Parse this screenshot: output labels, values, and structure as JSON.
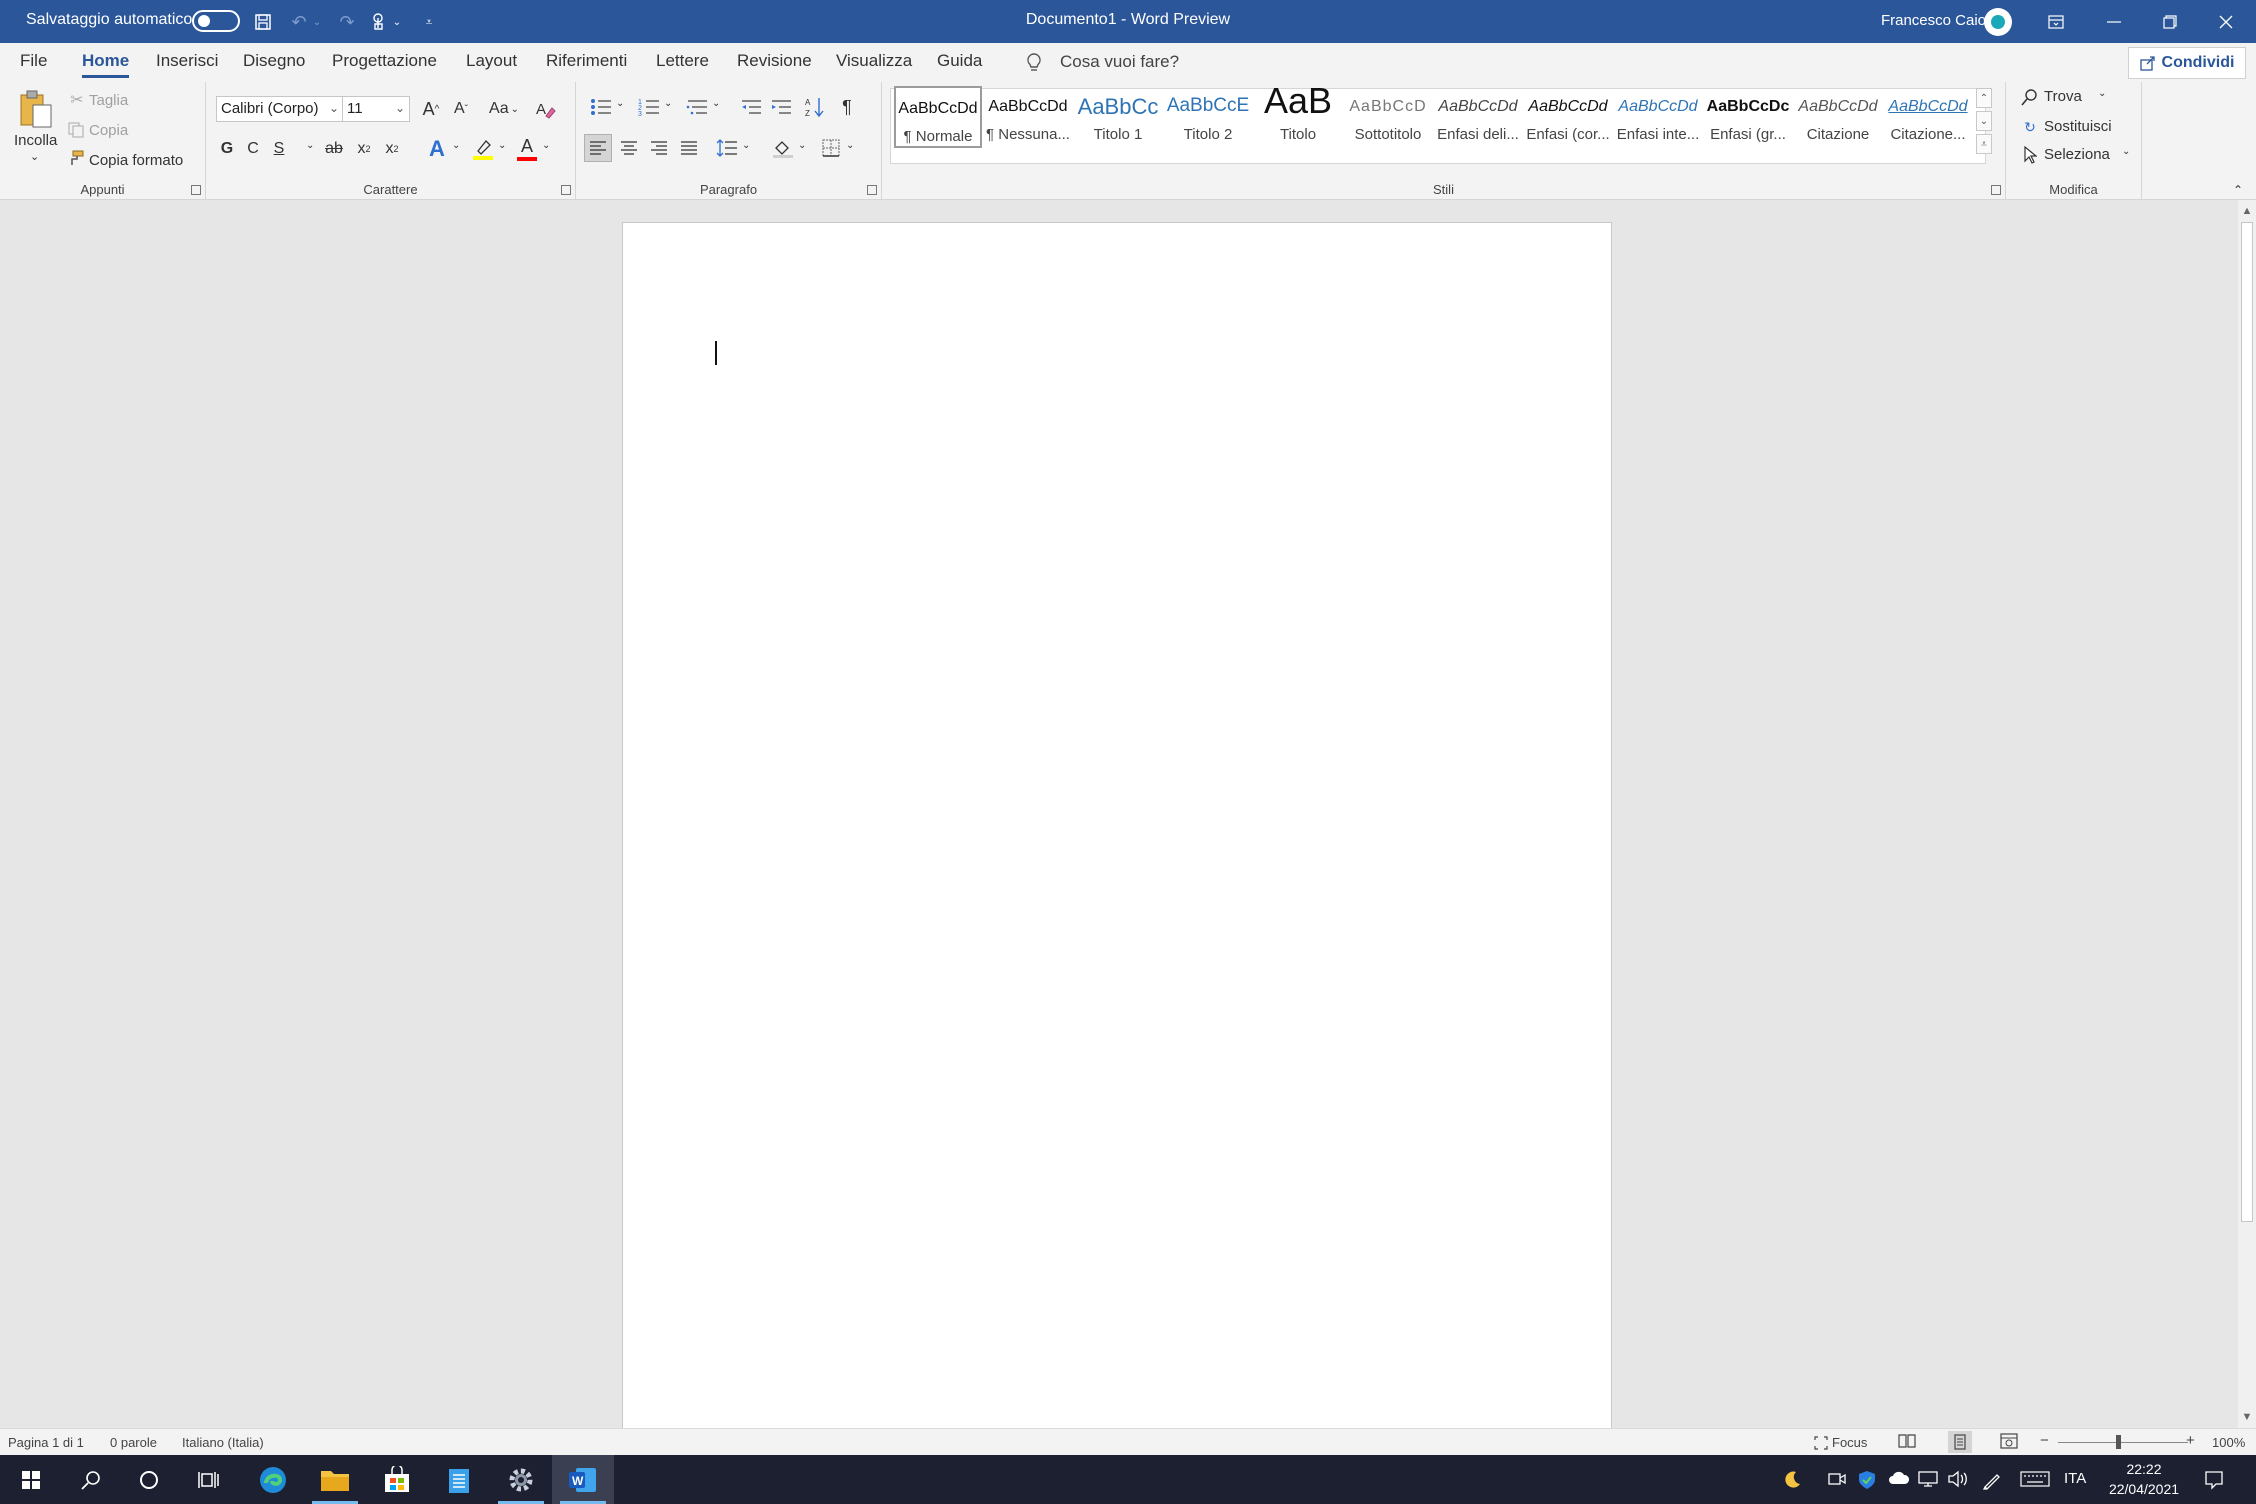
{
  "titlebar": {
    "autosave_label": "Salvataggio automatico",
    "document_title": "Documento1  -  Word Preview",
    "user_name": "Francesco Caio"
  },
  "menu": {
    "tabs": [
      "File",
      "Home",
      "Inserisci",
      "Disegno",
      "Progettazione",
      "Layout",
      "Riferimenti",
      "Lettere",
      "Revisione",
      "Visualizza",
      "Guida"
    ],
    "active_tab": "Home",
    "tell_me": "Cosa vuoi fare?",
    "share": "Condividi"
  },
  "ribbon": {
    "clipboard": {
      "label": "Appunti",
      "paste": "Incolla",
      "cut": "Taglia",
      "copy": "Copia",
      "format_painter": "Copia formato"
    },
    "font": {
      "label": "Carattere",
      "font_name": "Calibri (Corpo)",
      "font_size": "11",
      "change_case": "Aa",
      "bold": "G",
      "italic": "C",
      "underline": "S",
      "strikethrough": "ab",
      "subscript": "x",
      "superscript": "x",
      "grow": "A",
      "shrink": "A",
      "text_effects": "A",
      "font_color": "A",
      "highlight_color": "#ffff00",
      "font_color_value": "#ff0000"
    },
    "paragraph": {
      "label": "Paragrafo",
      "show_marks": "¶"
    },
    "styles": {
      "label": "Stili",
      "items": [
        {
          "sample": "AaBbCcDd",
          "name": "¶ Normale"
        },
        {
          "sample": "AaBbCcDd",
          "name": "¶ Nessuna..."
        },
        {
          "sample": "AaBbCc",
          "name": "Titolo 1"
        },
        {
          "sample": "AaBbCcE",
          "name": "Titolo 2"
        },
        {
          "sample": "AaB",
          "name": "Titolo"
        },
        {
          "sample": "AaBbCcD",
          "name": "Sottotitolo"
        },
        {
          "sample": "AaBbCcDd",
          "name": "Enfasi deli..."
        },
        {
          "sample": "AaBbCcDd",
          "name": "Enfasi (cor..."
        },
        {
          "sample": "AaBbCcDd",
          "name": "Enfasi inte..."
        },
        {
          "sample": "AaBbCcDc",
          "name": "Enfasi (gr..."
        },
        {
          "sample": "AaBbCcDd",
          "name": "Citazione"
        },
        {
          "sample": "AaBbCcDd",
          "name": "Citazione..."
        }
      ]
    },
    "editing": {
      "label": "Modifica",
      "find": "Trova",
      "replace": "Sostituisci",
      "select": "Seleziona"
    }
  },
  "status": {
    "page": "Pagina 1 di 1",
    "words": "0 parole",
    "language": "Italiano (Italia)",
    "focus": "Focus",
    "zoom_minus": "−",
    "zoom_plus": "+",
    "zoom": "100%",
    "zoom_level": 1.0
  },
  "taskbar": {
    "language": "ITA",
    "time": "22:22",
    "date": "22/04/2021"
  },
  "colors": {
    "accent": "#2b579a",
    "taskbar": "#1c2030"
  }
}
